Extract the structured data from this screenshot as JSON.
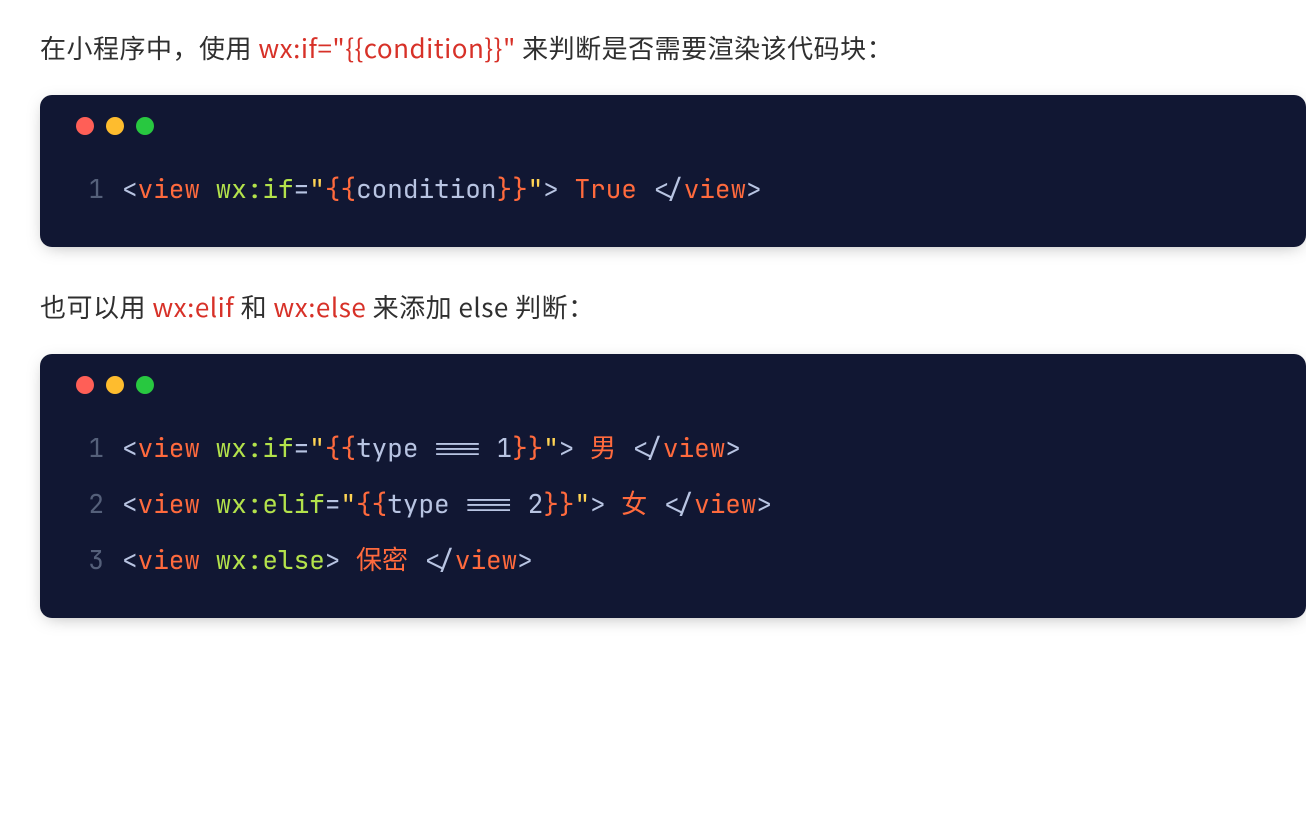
{
  "para1": {
    "pre": "在小程序中，使用 ",
    "hl": "wx:if=\"{{condition}}\"",
    "post": " 来判断是否需要渲染该代码块："
  },
  "code1": {
    "lines": [
      {
        "n": "1",
        "tokens": [
          {
            "cls": "punct",
            "t": "<"
          },
          {
            "cls": "tag",
            "t": "view"
          },
          {
            "cls": "punct",
            "t": " "
          },
          {
            "cls": "attr",
            "t": "wx:if"
          },
          {
            "cls": "op",
            "t": "="
          },
          {
            "cls": "str",
            "t": "\""
          },
          {
            "cls": "brace",
            "t": "{{"
          },
          {
            "cls": "expr",
            "t": "condition"
          },
          {
            "cls": "brace",
            "t": "}}"
          },
          {
            "cls": "str",
            "t": "\""
          },
          {
            "cls": "punct",
            "t": ">"
          },
          {
            "cls": "txt",
            "t": " True "
          },
          {
            "cls": "punct",
            "t": "</"
          },
          {
            "cls": "close",
            "t": "view"
          },
          {
            "cls": "punct",
            "t": ">"
          }
        ]
      }
    ]
  },
  "para2": {
    "pre": "也可以用 ",
    "hl1": "wx:elif",
    "mid": " 和 ",
    "hl2": "wx:else",
    "post": " 来添加 else 判断："
  },
  "code2": {
    "lines": [
      {
        "n": "1",
        "tokens": [
          {
            "cls": "punct",
            "t": "<"
          },
          {
            "cls": "tag",
            "t": "view"
          },
          {
            "cls": "punct",
            "t": " "
          },
          {
            "cls": "attr",
            "t": "wx:if"
          },
          {
            "cls": "op",
            "t": "="
          },
          {
            "cls": "str",
            "t": "\""
          },
          {
            "cls": "brace",
            "t": "{{"
          },
          {
            "cls": "expr",
            "t": "type === 1"
          },
          {
            "cls": "brace",
            "t": "}}"
          },
          {
            "cls": "str",
            "t": "\""
          },
          {
            "cls": "punct",
            "t": ">"
          },
          {
            "cls": "txt",
            "t": " 男 "
          },
          {
            "cls": "punct",
            "t": "</"
          },
          {
            "cls": "close",
            "t": "view"
          },
          {
            "cls": "punct",
            "t": ">"
          }
        ]
      },
      {
        "n": "2",
        "tokens": [
          {
            "cls": "punct",
            "t": "<"
          },
          {
            "cls": "tag",
            "t": "view"
          },
          {
            "cls": "punct",
            "t": " "
          },
          {
            "cls": "attr",
            "t": "wx:elif"
          },
          {
            "cls": "op",
            "t": "="
          },
          {
            "cls": "str",
            "t": "\""
          },
          {
            "cls": "brace",
            "t": "{{"
          },
          {
            "cls": "expr",
            "t": "type === 2"
          },
          {
            "cls": "brace",
            "t": "}}"
          },
          {
            "cls": "str",
            "t": "\""
          },
          {
            "cls": "punct",
            "t": ">"
          },
          {
            "cls": "txt",
            "t": " 女 "
          },
          {
            "cls": "punct",
            "t": "</"
          },
          {
            "cls": "close",
            "t": "view"
          },
          {
            "cls": "punct",
            "t": ">"
          }
        ]
      },
      {
        "n": "3",
        "tokens": [
          {
            "cls": "punct",
            "t": "<"
          },
          {
            "cls": "tag",
            "t": "view"
          },
          {
            "cls": "punct",
            "t": " "
          },
          {
            "cls": "attr",
            "t": "wx:else"
          },
          {
            "cls": "punct",
            "t": ">"
          },
          {
            "cls": "txt",
            "t": " 保密 "
          },
          {
            "cls": "punct",
            "t": "</"
          },
          {
            "cls": "close",
            "t": "view"
          },
          {
            "cls": "punct",
            "t": ">"
          }
        ]
      }
    ]
  }
}
